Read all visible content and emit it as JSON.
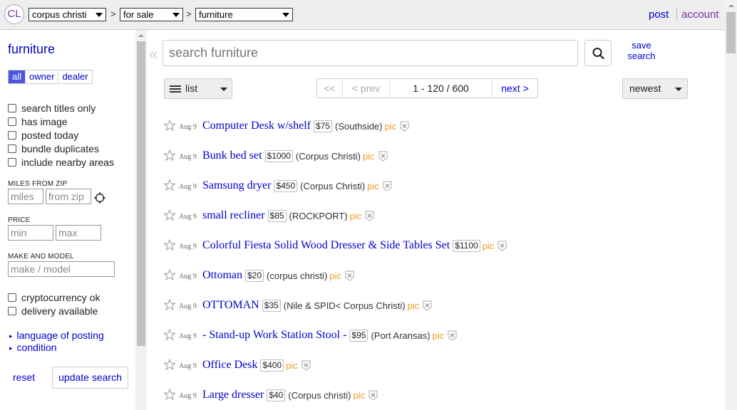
{
  "header": {
    "logo": "CL",
    "area_select": "corpus christi",
    "section_select": "for sale",
    "category_select": "furniture",
    "separator": ">",
    "post_label": "post",
    "account_label": "account"
  },
  "sidebar": {
    "category_title": "furniture",
    "seller_tabs": [
      "all",
      "owner",
      "dealer"
    ],
    "checkboxes_top": [
      "search titles only",
      "has image",
      "posted today",
      "bundle duplicates",
      "include nearby areas"
    ],
    "miles_label": "MILES FROM ZIP",
    "miles_placeholder": "miles",
    "zip_placeholder": "from zip",
    "price_label": "PRICE",
    "min_placeholder": "min",
    "max_placeholder": "max",
    "make_label": "MAKE AND MODEL",
    "make_placeholder": "make / model",
    "checkboxes_bottom": [
      "cryptocurrency ok",
      "delivery available"
    ],
    "expanders": [
      "language of posting",
      "condition"
    ],
    "reset_label": "reset",
    "update_label": "update search"
  },
  "search": {
    "placeholder": "search furniture",
    "save_label": "save search"
  },
  "toolbar": {
    "view_label": "list",
    "pager_first": "<<",
    "pager_prev": "< prev",
    "pager_range": "1 - 120 / 600",
    "pager_next": "next >",
    "sort_label": "newest"
  },
  "results": [
    {
      "date": "Aug 9",
      "title": "Computer Desk w/shelf",
      "price": "$75",
      "location": "(Southside)",
      "pic": "pic"
    },
    {
      "date": "Aug 9",
      "title": "Bunk bed set",
      "price": "$1000",
      "location": "(Corpus Christi)",
      "pic": "pic"
    },
    {
      "date": "Aug 9",
      "title": "Samsung dryer",
      "price": "$450",
      "location": "(Corpus Christi)",
      "pic": "pic"
    },
    {
      "date": "Aug 9",
      "title": "small recliner",
      "price": "$85",
      "location": "(ROCKPORT)",
      "pic": "pic"
    },
    {
      "date": "Aug 9",
      "title": "Colorful Fiesta Solid Wood Dresser & Side Tables Set",
      "price": "$1100",
      "location": "",
      "pic": "pic"
    },
    {
      "date": "Aug 9",
      "title": "Ottoman",
      "price": "$20",
      "location": "(corpus christi)",
      "pic": "pic"
    },
    {
      "date": "Aug 9",
      "title": "OTTOMAN",
      "price": "$35",
      "location": "(Nile & SPID< Corpus Christi)",
      "pic": "pic"
    },
    {
      "date": "Aug 9",
      "title": "- Stand-up Work Station Stool -",
      "price": "$95",
      "location": "(Port Aransas)",
      "pic": "pic"
    },
    {
      "date": "Aug 9",
      "title": "Office Desk",
      "price": "$400",
      "location": "",
      "pic": "pic"
    },
    {
      "date": "Aug 9",
      "title": "Large dresser",
      "price": "$40",
      "location": "(Corpus christi)",
      "pic": "pic"
    }
  ]
}
